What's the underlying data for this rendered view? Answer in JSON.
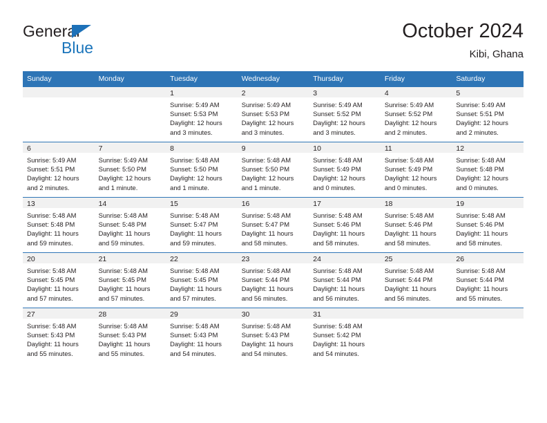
{
  "brand": {
    "name_top": "General",
    "name_bottom": "Blue",
    "triangle_color": "#1d71b8",
    "blue_text_color": "#1b75bb"
  },
  "header": {
    "title": "October 2024",
    "subtitle": "Kibi, Ghana"
  },
  "theme": {
    "header_row_bg": "#2e75b6",
    "row_separator": "#2e75b6",
    "daynum_strip_bg": "#f1f1f1",
    "text": "#231f20",
    "page_bg": "#ffffff"
  },
  "calendar": {
    "weekday_headers": [
      "Sunday",
      "Monday",
      "Tuesday",
      "Wednesday",
      "Thursday",
      "Friday",
      "Saturday"
    ],
    "weeks": [
      [
        {
          "day": "",
          "sunrise": "",
          "sunset": "",
          "daylight_line1": "",
          "daylight_line2": ""
        },
        {
          "day": "",
          "sunrise": "",
          "sunset": "",
          "daylight_line1": "",
          "daylight_line2": ""
        },
        {
          "day": "1",
          "sunrise": "Sunrise: 5:49 AM",
          "sunset": "Sunset: 5:53 PM",
          "daylight_line1": "Daylight: 12 hours",
          "daylight_line2": "and 3 minutes."
        },
        {
          "day": "2",
          "sunrise": "Sunrise: 5:49 AM",
          "sunset": "Sunset: 5:53 PM",
          "daylight_line1": "Daylight: 12 hours",
          "daylight_line2": "and 3 minutes."
        },
        {
          "day": "3",
          "sunrise": "Sunrise: 5:49 AM",
          "sunset": "Sunset: 5:52 PM",
          "daylight_line1": "Daylight: 12 hours",
          "daylight_line2": "and 3 minutes."
        },
        {
          "day": "4",
          "sunrise": "Sunrise: 5:49 AM",
          "sunset": "Sunset: 5:52 PM",
          "daylight_line1": "Daylight: 12 hours",
          "daylight_line2": "and 2 minutes."
        },
        {
          "day": "5",
          "sunrise": "Sunrise: 5:49 AM",
          "sunset": "Sunset: 5:51 PM",
          "daylight_line1": "Daylight: 12 hours",
          "daylight_line2": "and 2 minutes."
        }
      ],
      [
        {
          "day": "6",
          "sunrise": "Sunrise: 5:49 AM",
          "sunset": "Sunset: 5:51 PM",
          "daylight_line1": "Daylight: 12 hours",
          "daylight_line2": "and 2 minutes."
        },
        {
          "day": "7",
          "sunrise": "Sunrise: 5:49 AM",
          "sunset": "Sunset: 5:50 PM",
          "daylight_line1": "Daylight: 12 hours",
          "daylight_line2": "and 1 minute."
        },
        {
          "day": "8",
          "sunrise": "Sunrise: 5:48 AM",
          "sunset": "Sunset: 5:50 PM",
          "daylight_line1": "Daylight: 12 hours",
          "daylight_line2": "and 1 minute."
        },
        {
          "day": "9",
          "sunrise": "Sunrise: 5:48 AM",
          "sunset": "Sunset: 5:50 PM",
          "daylight_line1": "Daylight: 12 hours",
          "daylight_line2": "and 1 minute."
        },
        {
          "day": "10",
          "sunrise": "Sunrise: 5:48 AM",
          "sunset": "Sunset: 5:49 PM",
          "daylight_line1": "Daylight: 12 hours",
          "daylight_line2": "and 0 minutes."
        },
        {
          "day": "11",
          "sunrise": "Sunrise: 5:48 AM",
          "sunset": "Sunset: 5:49 PM",
          "daylight_line1": "Daylight: 12 hours",
          "daylight_line2": "and 0 minutes."
        },
        {
          "day": "12",
          "sunrise": "Sunrise: 5:48 AM",
          "sunset": "Sunset: 5:48 PM",
          "daylight_line1": "Daylight: 12 hours",
          "daylight_line2": "and 0 minutes."
        }
      ],
      [
        {
          "day": "13",
          "sunrise": "Sunrise: 5:48 AM",
          "sunset": "Sunset: 5:48 PM",
          "daylight_line1": "Daylight: 11 hours",
          "daylight_line2": "and 59 minutes."
        },
        {
          "day": "14",
          "sunrise": "Sunrise: 5:48 AM",
          "sunset": "Sunset: 5:48 PM",
          "daylight_line1": "Daylight: 11 hours",
          "daylight_line2": "and 59 minutes."
        },
        {
          "day": "15",
          "sunrise": "Sunrise: 5:48 AM",
          "sunset": "Sunset: 5:47 PM",
          "daylight_line1": "Daylight: 11 hours",
          "daylight_line2": "and 59 minutes."
        },
        {
          "day": "16",
          "sunrise": "Sunrise: 5:48 AM",
          "sunset": "Sunset: 5:47 PM",
          "daylight_line1": "Daylight: 11 hours",
          "daylight_line2": "and 58 minutes."
        },
        {
          "day": "17",
          "sunrise": "Sunrise: 5:48 AM",
          "sunset": "Sunset: 5:46 PM",
          "daylight_line1": "Daylight: 11 hours",
          "daylight_line2": "and 58 minutes."
        },
        {
          "day": "18",
          "sunrise": "Sunrise: 5:48 AM",
          "sunset": "Sunset: 5:46 PM",
          "daylight_line1": "Daylight: 11 hours",
          "daylight_line2": "and 58 minutes."
        },
        {
          "day": "19",
          "sunrise": "Sunrise: 5:48 AM",
          "sunset": "Sunset: 5:46 PM",
          "daylight_line1": "Daylight: 11 hours",
          "daylight_line2": "and 58 minutes."
        }
      ],
      [
        {
          "day": "20",
          "sunrise": "Sunrise: 5:48 AM",
          "sunset": "Sunset: 5:45 PM",
          "daylight_line1": "Daylight: 11 hours",
          "daylight_line2": "and 57 minutes."
        },
        {
          "day": "21",
          "sunrise": "Sunrise: 5:48 AM",
          "sunset": "Sunset: 5:45 PM",
          "daylight_line1": "Daylight: 11 hours",
          "daylight_line2": "and 57 minutes."
        },
        {
          "day": "22",
          "sunrise": "Sunrise: 5:48 AM",
          "sunset": "Sunset: 5:45 PM",
          "daylight_line1": "Daylight: 11 hours",
          "daylight_line2": "and 57 minutes."
        },
        {
          "day": "23",
          "sunrise": "Sunrise: 5:48 AM",
          "sunset": "Sunset: 5:44 PM",
          "daylight_line1": "Daylight: 11 hours",
          "daylight_line2": "and 56 minutes."
        },
        {
          "day": "24",
          "sunrise": "Sunrise: 5:48 AM",
          "sunset": "Sunset: 5:44 PM",
          "daylight_line1": "Daylight: 11 hours",
          "daylight_line2": "and 56 minutes."
        },
        {
          "day": "25",
          "sunrise": "Sunrise: 5:48 AM",
          "sunset": "Sunset: 5:44 PM",
          "daylight_line1": "Daylight: 11 hours",
          "daylight_line2": "and 56 minutes."
        },
        {
          "day": "26",
          "sunrise": "Sunrise: 5:48 AM",
          "sunset": "Sunset: 5:44 PM",
          "daylight_line1": "Daylight: 11 hours",
          "daylight_line2": "and 55 minutes."
        }
      ],
      [
        {
          "day": "27",
          "sunrise": "Sunrise: 5:48 AM",
          "sunset": "Sunset: 5:43 PM",
          "daylight_line1": "Daylight: 11 hours",
          "daylight_line2": "and 55 minutes."
        },
        {
          "day": "28",
          "sunrise": "Sunrise: 5:48 AM",
          "sunset": "Sunset: 5:43 PM",
          "daylight_line1": "Daylight: 11 hours",
          "daylight_line2": "and 55 minutes."
        },
        {
          "day": "29",
          "sunrise": "Sunrise: 5:48 AM",
          "sunset": "Sunset: 5:43 PM",
          "daylight_line1": "Daylight: 11 hours",
          "daylight_line2": "and 54 minutes."
        },
        {
          "day": "30",
          "sunrise": "Sunrise: 5:48 AM",
          "sunset": "Sunset: 5:43 PM",
          "daylight_line1": "Daylight: 11 hours",
          "daylight_line2": "and 54 minutes."
        },
        {
          "day": "31",
          "sunrise": "Sunrise: 5:48 AM",
          "sunset": "Sunset: 5:42 PM",
          "daylight_line1": "Daylight: 11 hours",
          "daylight_line2": "and 54 minutes."
        },
        {
          "day": "",
          "sunrise": "",
          "sunset": "",
          "daylight_line1": "",
          "daylight_line2": ""
        },
        {
          "day": "",
          "sunrise": "",
          "sunset": "",
          "daylight_line1": "",
          "daylight_line2": ""
        }
      ]
    ]
  }
}
